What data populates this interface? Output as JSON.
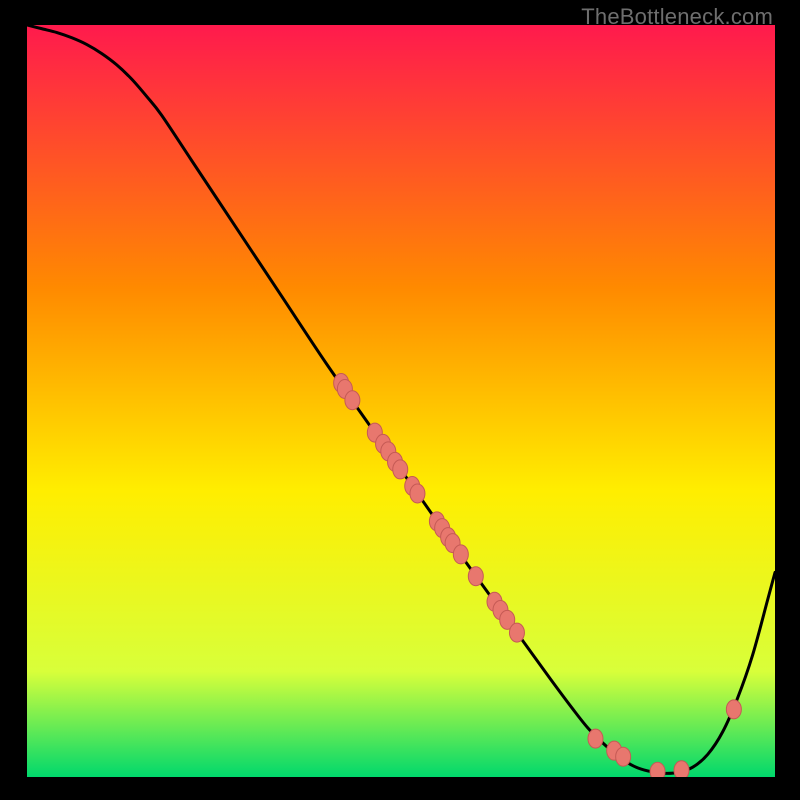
{
  "watermark": "TheBottleneck.com",
  "colors": {
    "curve": "#000000",
    "dot_fill": "#e8776e",
    "dot_stroke": "#c55a55",
    "gradient_top": "#ff1a4d",
    "gradient_mid_upper": "#ff8a00",
    "gradient_mid": "#ffee00",
    "gradient_lower": "#d8ff3a",
    "gradient_bottom": "#00d86c",
    "frame": "#000000"
  },
  "chart_data": {
    "type": "line",
    "title": "",
    "xlabel": "",
    "ylabel": "",
    "xlim": [
      0,
      100
    ],
    "ylim": [
      0,
      100
    ],
    "curve": {
      "x": [
        0,
        2,
        4,
        6,
        8,
        10,
        12,
        14,
        16,
        18,
        22,
        28,
        34,
        40,
        46,
        52,
        58,
        62,
        66,
        70,
        73,
        75,
        77,
        79,
        81,
        83,
        85,
        87,
        89,
        91,
        93,
        95,
        97,
        99,
        100
      ],
      "y": [
        100,
        99.5,
        99,
        98.3,
        97.4,
        96.2,
        94.7,
        92.8,
        90.5,
        88,
        82,
        73,
        64,
        55,
        46.5,
        38,
        29.5,
        24,
        18.5,
        13,
        9,
        6.5,
        4.5,
        2.8,
        1.5,
        0.8,
        0.5,
        0.6,
        1.3,
        3,
        6,
        10.5,
        16.2,
        23.5,
        27.2
      ]
    },
    "dots": [
      {
        "x": 42.0,
        "y": 52.4
      },
      {
        "x": 42.5,
        "y": 51.6
      },
      {
        "x": 43.5,
        "y": 50.1
      },
      {
        "x": 46.5,
        "y": 45.8
      },
      {
        "x": 47.6,
        "y": 44.3
      },
      {
        "x": 48.3,
        "y": 43.3
      },
      {
        "x": 49.2,
        "y": 41.9
      },
      {
        "x": 49.9,
        "y": 40.9
      },
      {
        "x": 51.5,
        "y": 38.7
      },
      {
        "x": 52.2,
        "y": 37.7
      },
      {
        "x": 54.8,
        "y": 34.0
      },
      {
        "x": 55.5,
        "y": 33.1
      },
      {
        "x": 56.3,
        "y": 31.9
      },
      {
        "x": 56.9,
        "y": 31.1
      },
      {
        "x": 58.0,
        "y": 29.6
      },
      {
        "x": 60.0,
        "y": 26.7
      },
      {
        "x": 62.5,
        "y": 23.3
      },
      {
        "x": 63.3,
        "y": 22.2
      },
      {
        "x": 64.2,
        "y": 20.9
      },
      {
        "x": 65.5,
        "y": 19.2
      },
      {
        "x": 76.0,
        "y": 5.1
      },
      {
        "x": 78.5,
        "y": 3.5
      },
      {
        "x": 79.7,
        "y": 2.7
      },
      {
        "x": 84.3,
        "y": 0.7
      },
      {
        "x": 87.5,
        "y": 0.9
      },
      {
        "x": 94.5,
        "y": 9.0
      }
    ]
  }
}
